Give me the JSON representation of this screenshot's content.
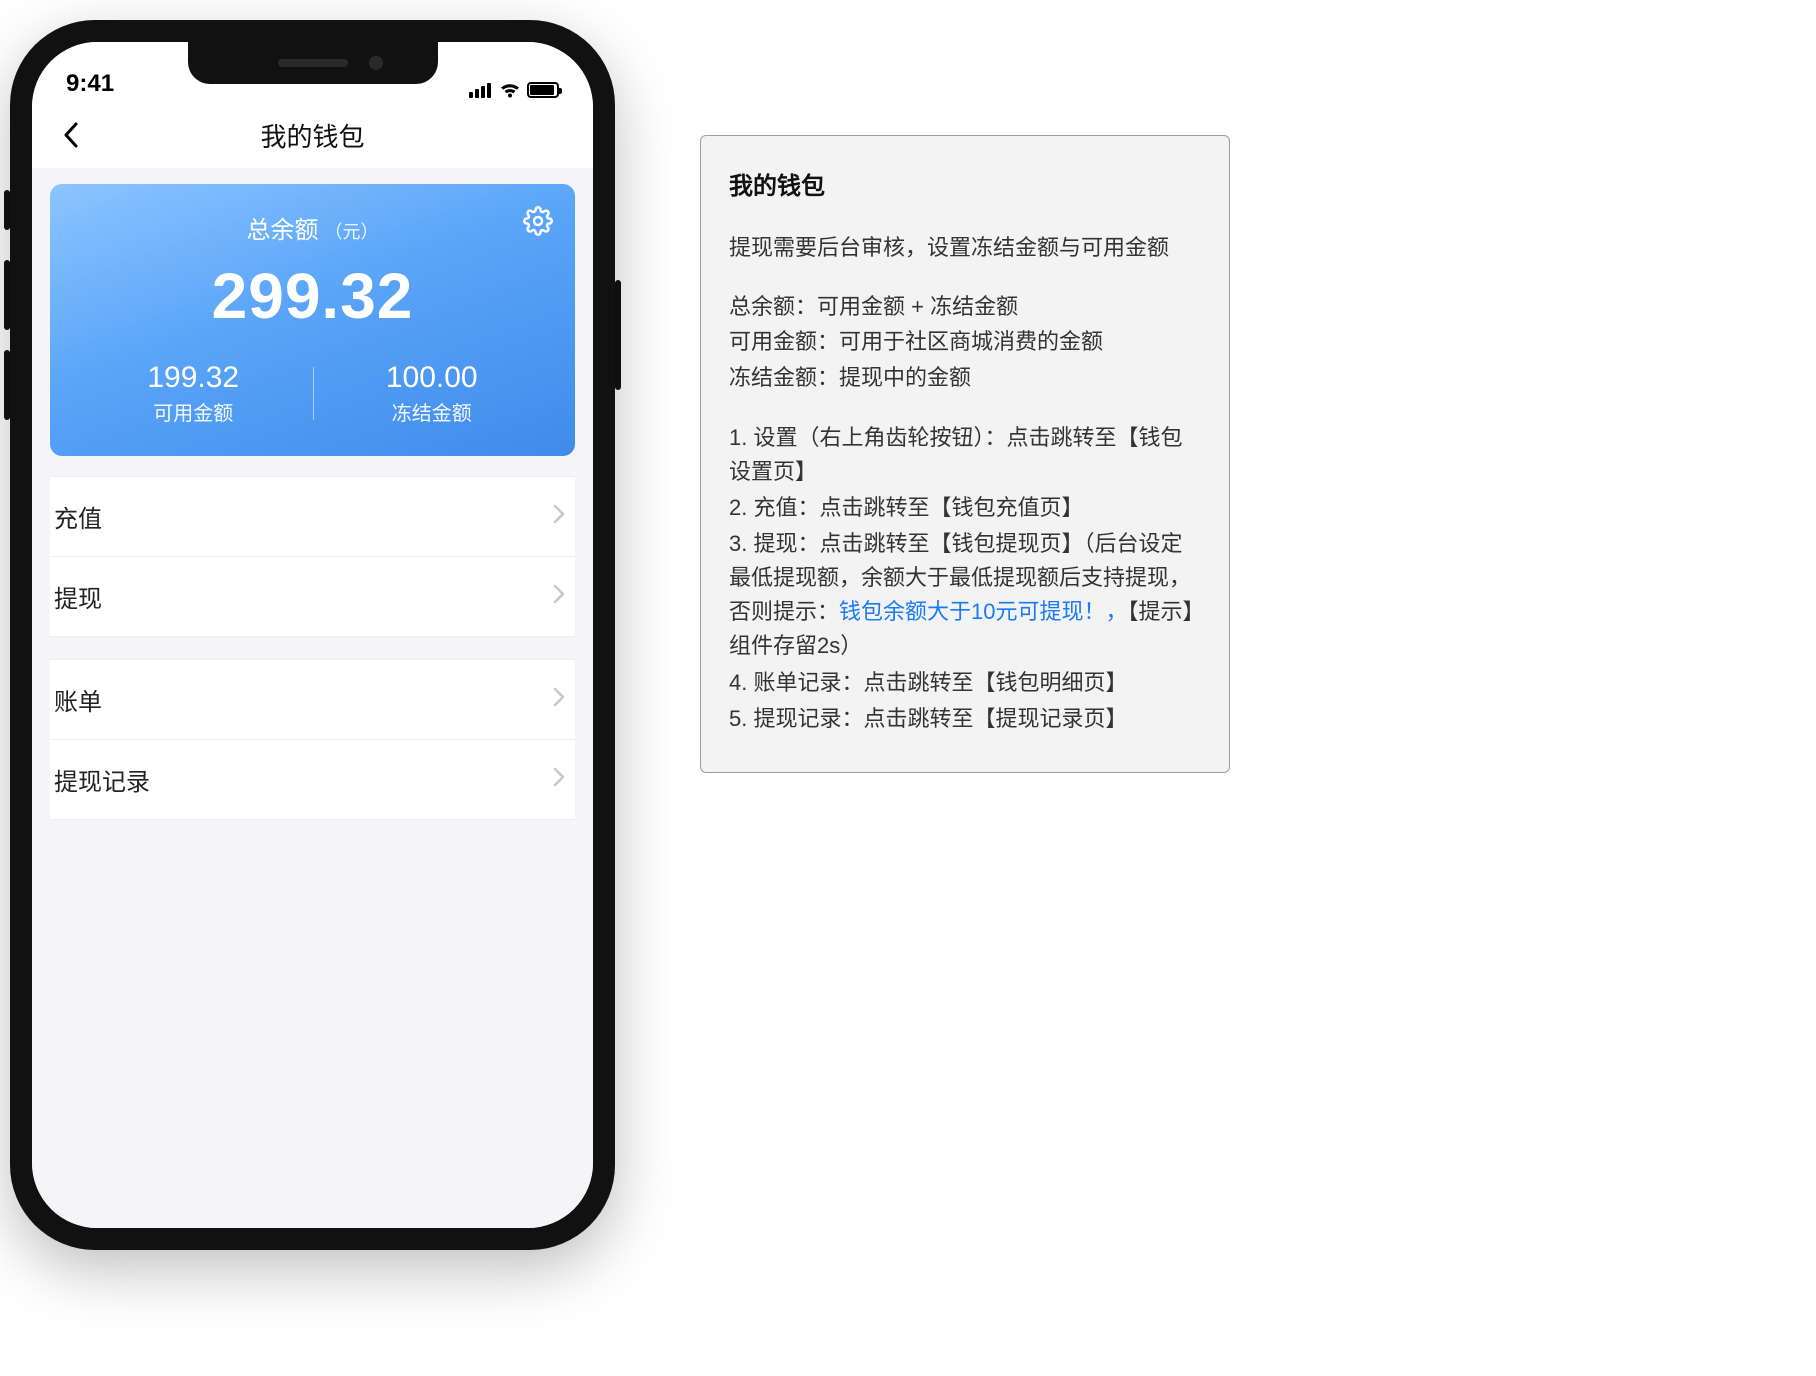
{
  "status": {
    "time": "9:41"
  },
  "nav": {
    "title": "我的钱包"
  },
  "balance": {
    "label": "总余额",
    "unit": "（元）",
    "total": "299.32",
    "available": {
      "value": "199.32",
      "label": "可用金额"
    },
    "frozen": {
      "value": "100.00",
      "label": "冻结金额"
    }
  },
  "menu": {
    "group1": [
      {
        "label": "充值"
      },
      {
        "label": "提现"
      }
    ],
    "group2": [
      {
        "label": "账单"
      },
      {
        "label": "提现记录"
      }
    ]
  },
  "anno": {
    "title": "我的钱包",
    "intro": "提现需要后台审核，设置冻结金额与可用金额",
    "defs": [
      "总余额：可用金额 + 冻结金额",
      "可用金额：可用于社区商城消费的金额",
      "冻结金额：提现中的金额"
    ],
    "steps": {
      "s1": "1. 设置（右上角齿轮按钮）：点击跳转至【钱包设置页】",
      "s2": "2. 充值：点击跳转至【钱包充值页】",
      "s3a": "3. 提现：点击跳转至【钱包提现页】（后台设定最低提现额，余额大于最低提现额后支持提现，否则提示：",
      "s3b": "钱包余额大于10元可提现！，",
      "s3c": "【提示】组件存留2s）",
      "s4": "4. 账单记录：点击跳转至【钱包明细页】",
      "s5": "5. 提现记录：点击跳转至【提现记录页】"
    }
  }
}
